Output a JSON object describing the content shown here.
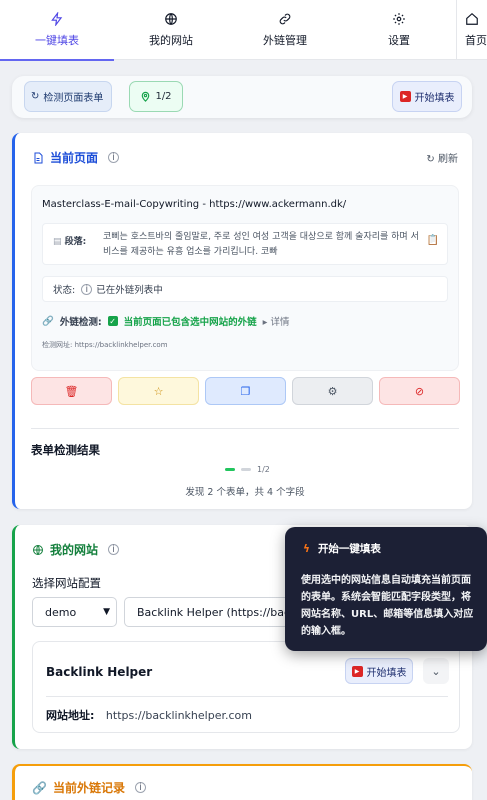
{
  "nav": {
    "tabs": [
      {
        "label": "一键填表",
        "icon": "bolt-icon"
      },
      {
        "label": "我的网站",
        "icon": "globe-icon"
      },
      {
        "label": "外链管理",
        "icon": "link-icon"
      },
      {
        "label": "设置",
        "icon": "gear-icon"
      },
      {
        "label": "首页",
        "icon": "home-icon"
      }
    ]
  },
  "toolbar": {
    "detect_label": "检测页面表单",
    "count_label": "1/2",
    "fill_label": "开始填表"
  },
  "current_page": {
    "title": "当前页面",
    "refresh_label": "刷新",
    "page_title": "Masterclass-E-mail-Copywriting - https://www.ackermann.dk/",
    "paragraph_label": "段落:",
    "paragraph_text": "코삐는 호스트바의 줄임말로, 주로 성인 여성 고객을 대상으로 함께 술자리를 하며 서비스를 제공하는 유흥 업소를 가리킵니다. 코빠",
    "status_label": "状态:",
    "status_text": "已在外链列表中",
    "link_check_label": "外链检测:",
    "link_check_text": "当前页面已包含选中网站的外链",
    "details_label": "详情",
    "detect_url": "检测网址: https://backlinkhelper.com"
  },
  "form_results": {
    "title": "表单检测结果",
    "page": "1/2",
    "summary": "发现 2 个表单，共 4 个字段"
  },
  "my_site": {
    "title": "我的网站",
    "select_label": "选择网站配置",
    "config_value": "demo",
    "site_value": "Backlink Helper (https://backlinkhelper.com)",
    "site_name": "Backlink Helper",
    "fill_label": "开始填表",
    "address_label": "网站地址:",
    "address_value": "https://backlinkhelper.com"
  },
  "record": {
    "title": "当前外链记录"
  },
  "tooltip": {
    "title": "开始一键填表",
    "body": "使用选中的网站信息自动填充当前页面的表单。系统会智能匹配字段类型，将网站名称、URL、邮箱等信息填入对应的输入框。"
  },
  "colors": {
    "accent": "#4f46e5",
    "blue": "#2563eb",
    "green": "#16a34a",
    "orange": "#f59e0b",
    "tooltip_bg": "#1c2035"
  }
}
